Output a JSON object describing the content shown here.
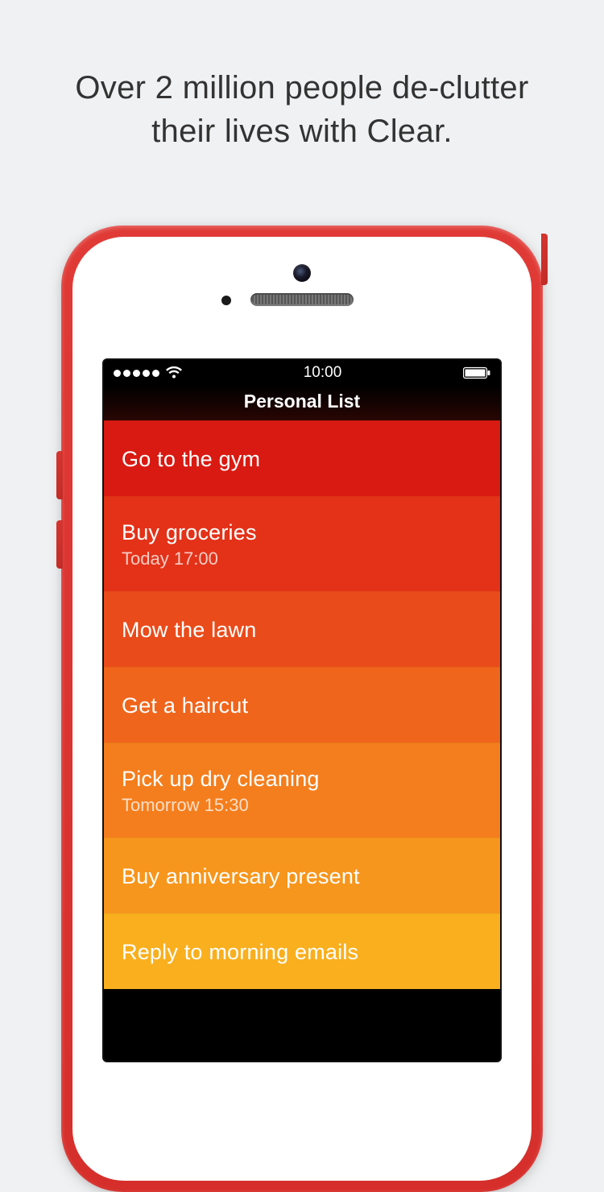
{
  "headline_line1": "Over 2 million people de-clutter",
  "headline_line2": "their lives with Clear.",
  "status": {
    "time": "10:00"
  },
  "list": {
    "title": "Personal List",
    "items": [
      {
        "title": "Go to the gym",
        "sub": null
      },
      {
        "title": "Buy groceries",
        "sub": "Today 17:00"
      },
      {
        "title": "Mow the lawn",
        "sub": null
      },
      {
        "title": "Get a haircut",
        "sub": null
      },
      {
        "title": "Pick up dry cleaning",
        "sub": "Tomorrow 15:30"
      },
      {
        "title": "Buy anniversary present",
        "sub": null
      },
      {
        "title": "Reply to morning emails",
        "sub": null
      }
    ]
  }
}
